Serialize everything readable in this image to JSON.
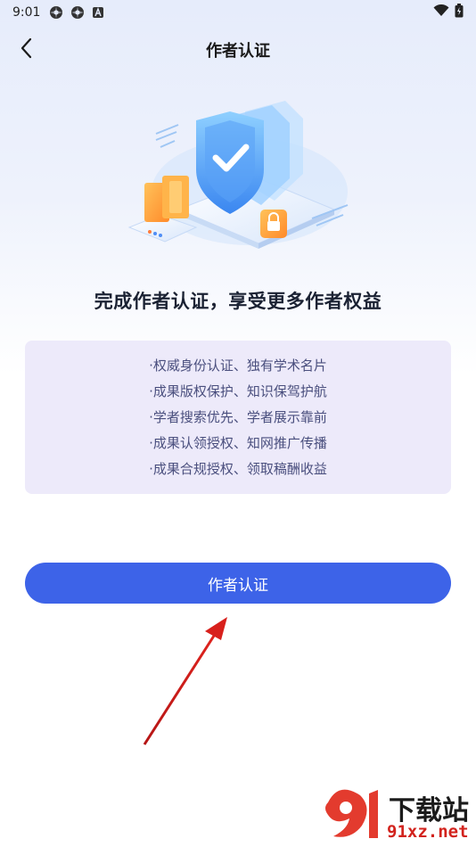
{
  "status_bar": {
    "time": "9:01",
    "left_icons": [
      "gear-icon",
      "gear-icon",
      "a-badge-icon"
    ],
    "right_icons": [
      "wifi-icon",
      "battery-icon"
    ]
  },
  "nav": {
    "title": "作者认证",
    "back_icon": "chevron-left-icon"
  },
  "hero": {
    "illustration": "shield-check-illustration",
    "colors": {
      "shield": "#4f8df5",
      "lock": "#ff8a3d",
      "box": "#ffa33a"
    }
  },
  "headline": "完成作者认证，享受更多作者权益",
  "benefits": [
    "·权威身份认证、独有学术名片",
    "·成果版权保护、知识保驾护航",
    "·学者搜索优先、学者展示靠前",
    "·成果认领授权、知网推广传播",
    "·成果合规授权、领取稿酬收益"
  ],
  "primary_button": {
    "label": "作者认证",
    "color": "#3d63e8"
  },
  "annotation": {
    "arrow_color": "#d8201c"
  },
  "watermark": {
    "top": "下载站",
    "bottom": "91xz.net",
    "logo": "91-logo-icon"
  }
}
